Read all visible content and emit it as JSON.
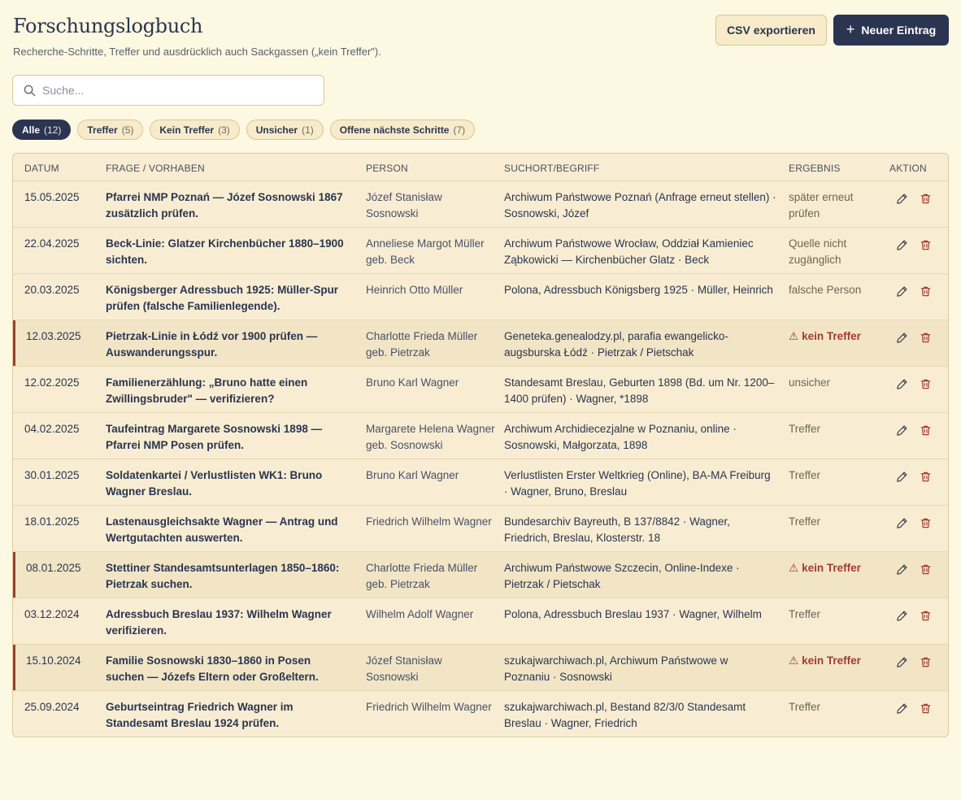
{
  "header": {
    "title": "Forschungslogbuch",
    "subtitle": "Recherche-Schritte, Treffer und ausdrücklich auch Sackgassen („kein Treffer\")."
  },
  "toolbar": {
    "export_label": "CSV exportieren",
    "new_label": "Neuer Eintrag"
  },
  "search": {
    "placeholder": "Suche...",
    "value": ""
  },
  "filters": [
    {
      "label": "Alle",
      "count": "(12)",
      "active": true
    },
    {
      "label": "Treffer",
      "count": "(5)",
      "active": false
    },
    {
      "label": "Kein Treffer",
      "count": "(3)",
      "active": false
    },
    {
      "label": "Unsicher",
      "count": "(1)",
      "active": false
    },
    {
      "label": "Offene nächste Schritte",
      "count": "(7)",
      "active": false
    }
  ],
  "table": {
    "headers": {
      "datum": "DATUM",
      "frage": "FRAGE / VORHABEN",
      "person": "PERSON",
      "ort": "SUCHORT/BEGRIFF",
      "ergebnis": "ERGEBNIS",
      "aktion": "AKTION"
    },
    "rows": [
      {
        "datum": "15.05.2025",
        "frage": "Pfarrei NMP Poznań — Józef Sosnowski 1867 zusätzlich prüfen.",
        "person": "Józef Stanisław Sosnowski",
        "ort": "Archiwum Państwowe Poznań (Anfrage erneut stellen) · Sosnowski, Józef",
        "ergebnis": "später erneut prüfen",
        "no_hit": false
      },
      {
        "datum": "22.04.2025",
        "frage": "Beck-Linie: Glatzer Kirchenbücher 1880–1900 sichten.",
        "person": "Anneliese Margot Müller geb. Beck",
        "ort": "Archiwum Państwowe Wrocław, Oddział Kamieniec Ząbkowicki — Kirchenbücher Glatz · Beck",
        "ergebnis": "Quelle nicht zugänglich",
        "no_hit": false
      },
      {
        "datum": "20.03.2025",
        "frage": "Königsberger Adressbuch 1925: Müller-Spur prüfen (falsche Familienlegende).",
        "person": "Heinrich Otto Müller",
        "ort": "Polona, Adressbuch Königsberg 1925 · Müller, Heinrich",
        "ergebnis": "falsche Person",
        "no_hit": false
      },
      {
        "datum": "12.03.2025",
        "frage": "Pietrzak-Linie in Łódź vor 1900 prüfen — Auswanderungsspur.",
        "person": "Charlotte Frieda Müller geb. Pietrzak",
        "ort": "Geneteka.genealodzy.pl, parafia ewangelicko-augsburska Łódź · Pietrzak / Pietschak",
        "ergebnis": "kein Treffer",
        "no_hit": true
      },
      {
        "datum": "12.02.2025",
        "frage": "Familienerzählung: „Bruno hatte einen Zwillingsbruder\" — verifizieren?",
        "person": "Bruno Karl Wagner",
        "ort": "Standesamt Breslau, Geburten 1898 (Bd. um Nr. 1200–1400 prüfen) · Wagner, *1898",
        "ergebnis": "unsicher",
        "no_hit": false
      },
      {
        "datum": "04.02.2025",
        "frage": "Taufeintrag Margarete Sosnowski 1898 — Pfarrei NMP Posen prüfen.",
        "person": "Margarete Helena Wagner geb. Sosnowski",
        "ort": "Archiwum Archidiecezjalne w Poznaniu, online · Sosnowski, Małgorzata, 1898",
        "ergebnis": "Treffer",
        "no_hit": false
      },
      {
        "datum": "30.01.2025",
        "frage": "Soldatenkartei / Verlustlisten WK1: Bruno Wagner Breslau.",
        "person": "Bruno Karl Wagner",
        "ort": "Verlustlisten Erster Weltkrieg (Online), BA-MA Freiburg · Wagner, Bruno, Breslau",
        "ergebnis": "Treffer",
        "no_hit": false
      },
      {
        "datum": "18.01.2025",
        "frage": "Lastenausgleichsakte Wagner — Antrag und Wertgutachten auswerten.",
        "person": "Friedrich Wilhelm Wagner",
        "ort": "Bundesarchiv Bayreuth, B 137/8842 · Wagner, Friedrich, Breslau, Klosterstr. 18",
        "ergebnis": "Treffer",
        "no_hit": false
      },
      {
        "datum": "08.01.2025",
        "frage": "Stettiner Standesamtsunterlagen 1850–1860: Pietrzak suchen.",
        "person": "Charlotte Frieda Müller geb. Pietrzak",
        "ort": "Archiwum Państwowe Szczecin, Online-Indexe · Pietrzak / Pietschak",
        "ergebnis": "kein Treffer",
        "no_hit": true
      },
      {
        "datum": "03.12.2024",
        "frage": "Adressbuch Breslau 1937: Wilhelm Wagner verifizieren.",
        "person": "Wilhelm Adolf Wagner",
        "ort": "Polona, Adressbuch Breslau 1937 · Wagner, Wilhelm",
        "ergebnis": "Treffer",
        "no_hit": false
      },
      {
        "datum": "15.10.2024",
        "frage": "Familie Sosnowski 1830–1860 in Posen suchen — Józefs Eltern oder Großeltern.",
        "person": "Józef Stanisław Sosnowski",
        "ort": "szukajwarchiwach.pl, Archiwum Państwowe w Poznaniu · Sosnowski",
        "ergebnis": "kein Treffer",
        "no_hit": true
      },
      {
        "datum": "25.09.2024",
        "frage": "Geburtseintrag Friedrich Wagner im Standesamt Breslau 1924 prüfen.",
        "person": "Friedrich Wilhelm Wagner",
        "ort": "szukajwarchiwach.pl, Bestand 82/3/0 Standesamt Breslau · Wagner, Friedrich",
        "ergebnis": "Treffer",
        "no_hit": false
      }
    ]
  },
  "icons": {
    "search": "search-icon",
    "plus": "plus-icon",
    "warning": "warning-icon",
    "edit": "pencil-icon",
    "delete": "trash-icon"
  },
  "colors": {
    "background": "#fdf8e1",
    "primary": "#2b3551",
    "surface": "#f8edd2",
    "no_hit_accent": "#a23c2e"
  }
}
